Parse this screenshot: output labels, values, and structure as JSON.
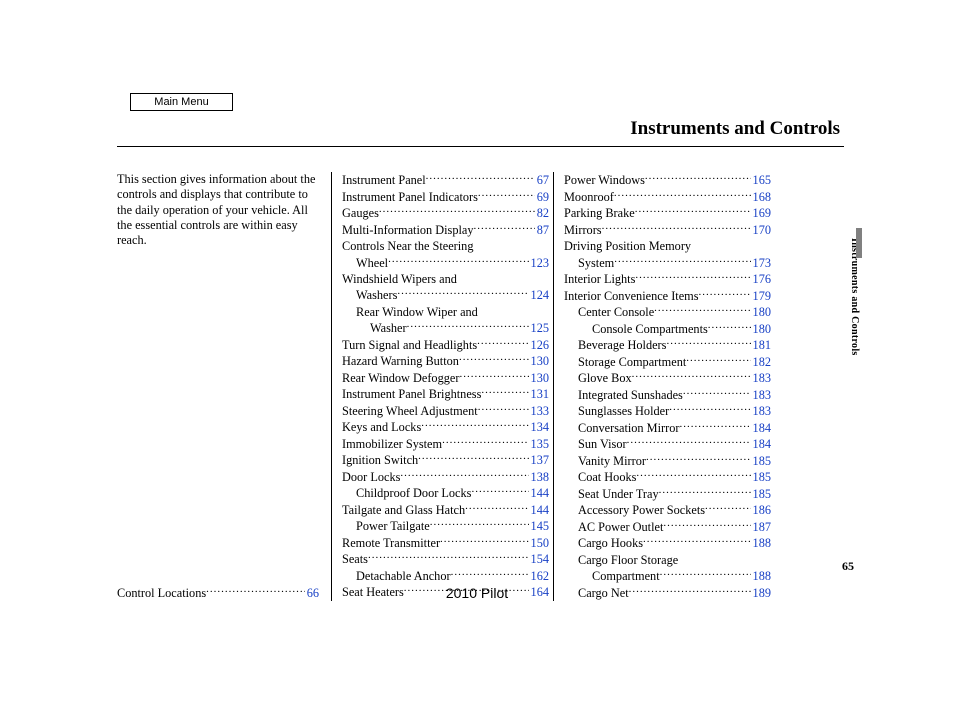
{
  "menu_label": "Main Menu",
  "title": "Instruments and Controls",
  "intro": "This section gives information about the controls and displays that contribute to the daily operation of your vehicle. All the essential controls are within easy reach.",
  "col1_bottom": {
    "label": "Control Locations",
    "page": "66"
  },
  "col2": [
    {
      "label": "Instrument Panel",
      "page": "67"
    },
    {
      "label": "Instrument Panel Indicators",
      "page": "69"
    },
    {
      "label": "Gauges",
      "page": "82"
    },
    {
      "label": "Multi-Information Display",
      "page": "87"
    },
    {
      "label": "Controls Near the Steering",
      "nopage": true
    },
    {
      "label": "Wheel",
      "page": "123",
      "lvl": 1
    },
    {
      "label": "Windshield Wipers and",
      "nopage": true
    },
    {
      "label": "Washers",
      "page": "124",
      "lvl": 1
    },
    {
      "label": "Rear Window Wiper and",
      "nopage": true,
      "lvl": 1
    },
    {
      "label": "Washer",
      "page": "125",
      "lvl": 2
    },
    {
      "label": "Turn Signal and Headlights",
      "page": "126"
    },
    {
      "label": "Hazard Warning Button",
      "page": "130"
    },
    {
      "label": "Rear Window Defogger",
      "page": "130"
    },
    {
      "label": "Instrument Panel Brightness",
      "page": "131"
    },
    {
      "label": "Steering Wheel Adjustment",
      "page": "133"
    },
    {
      "label": "Keys and Locks",
      "page": "134"
    },
    {
      "label": "Immobilizer System",
      "page": "135"
    },
    {
      "label": "Ignition Switch",
      "page": "137"
    },
    {
      "label": "Door Locks",
      "page": "138"
    },
    {
      "label": "Childproof Door Locks",
      "page": "144",
      "lvl": 1
    },
    {
      "label": "Tailgate and Glass Hatch",
      "page": "144"
    },
    {
      "label": "Power Tailgate",
      "page": "145",
      "lvl": 1
    },
    {
      "label": "Remote Transmitter",
      "page": "150"
    },
    {
      "label": "Seats",
      "page": "154"
    },
    {
      "label": "Detachable Anchor",
      "page": "162",
      "lvl": 1
    },
    {
      "label": "Seat Heaters",
      "page": "164"
    }
  ],
  "col3": [
    {
      "label": "Power Windows",
      "page": "165"
    },
    {
      "label": "Moonroof",
      "page": "168"
    },
    {
      "label": "Parking Brake",
      "page": "169"
    },
    {
      "label": "Mirrors",
      "page": "170"
    },
    {
      "label": "Driving Position Memory",
      "nopage": true
    },
    {
      "label": "System",
      "page": "173",
      "lvl": 1
    },
    {
      "label": "Interior Lights",
      "page": "176"
    },
    {
      "label": "Interior Convenience Items",
      "page": "179"
    },
    {
      "label": "Center Console",
      "page": "180",
      "lvl": 1
    },
    {
      "label": "Console Compartments",
      "page": "180",
      "lvl": 2
    },
    {
      "label": "Beverage Holders",
      "page": "181",
      "lvl": 1
    },
    {
      "label": "Storage Compartment",
      "page": "182",
      "lvl": 1
    },
    {
      "label": "Glove Box",
      "page": "183",
      "lvl": 1
    },
    {
      "label": "Integrated Sunshades",
      "page": "183",
      "lvl": 1
    },
    {
      "label": "Sunglasses Holder",
      "page": "183",
      "lvl": 1
    },
    {
      "label": "Conversation Mirror",
      "page": "184",
      "lvl": 1
    },
    {
      "label": "Sun Visor",
      "page": "184",
      "lvl": 1
    },
    {
      "label": "Vanity Mirror",
      "page": "185",
      "lvl": 1
    },
    {
      "label": "Coat Hooks",
      "page": "185",
      "lvl": 1
    },
    {
      "label": "Seat Under Tray",
      "page": "185",
      "lvl": 1
    },
    {
      "label": "Accessory Power Sockets",
      "page": "186",
      "lvl": 1
    },
    {
      "label": "AC Power Outlet",
      "page": "187",
      "lvl": 1
    },
    {
      "label": "Cargo Hooks",
      "page": "188",
      "lvl": 1
    },
    {
      "label": "Cargo Floor Storage",
      "nopage": true,
      "lvl": 1
    },
    {
      "label": "Compartment",
      "page": "188",
      "lvl": 2
    },
    {
      "label": "Cargo Net",
      "page": "189",
      "lvl": 1
    }
  ],
  "side_tab": "Instruments and Controls",
  "page_number": "65",
  "model_year": "2010 Pilot"
}
